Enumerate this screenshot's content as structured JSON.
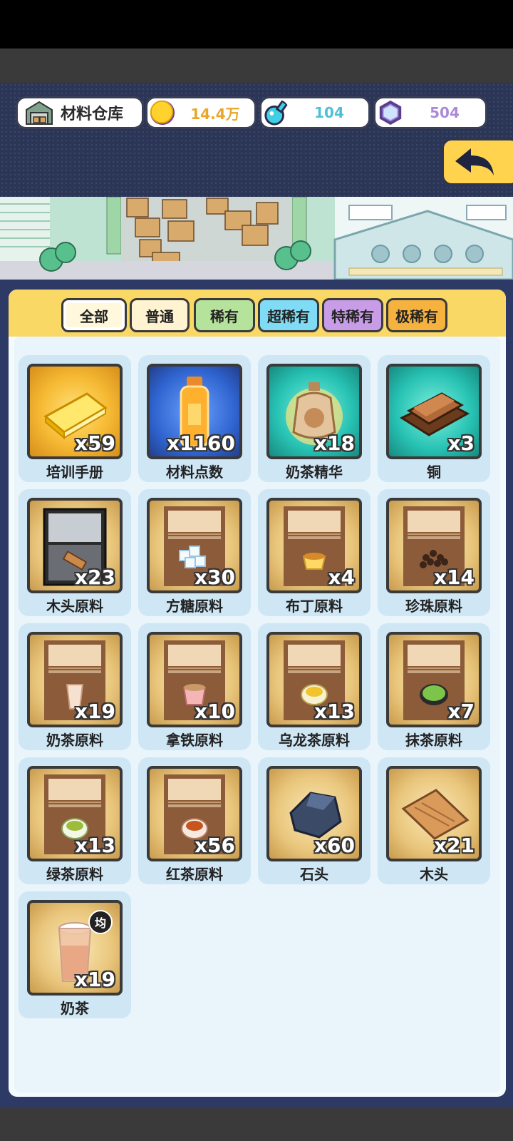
{
  "header": {
    "title": "材料仓库",
    "coins": "14.4万",
    "potion": "104",
    "gems": "504"
  },
  "colors": {
    "coin_text": "#e9a627",
    "potion_text": "#4fbfd8",
    "gem_text": "#a98bd8",
    "tab_all": "#fff8dc",
    "tab_common": "#fff3d2",
    "tab_rare": "#b5e39b",
    "tab_super": "#7fdcf4",
    "tab_special": "#c99ce8",
    "tab_extreme": "#f5b23e"
  },
  "tabs": [
    {
      "label": "全部",
      "active": true
    },
    {
      "label": "普通"
    },
    {
      "label": "稀有"
    },
    {
      "label": "超稀有"
    },
    {
      "label": "特稀有"
    },
    {
      "label": "极稀有"
    }
  ],
  "items": [
    {
      "name": "培训手册",
      "qty": "x59",
      "icon": "book-icon"
    },
    {
      "name": "材料点数",
      "qty": "x1160",
      "icon": "bottle-icon"
    },
    {
      "name": "奶茶精华",
      "qty": "x18",
      "icon": "essence-jar-icon"
    },
    {
      "name": "铜",
      "qty": "x3",
      "icon": "copper-ingot-icon"
    },
    {
      "name": "木头原料",
      "qty": "x23",
      "icon": "wood-box-icon"
    },
    {
      "name": "方糖原料",
      "qty": "x30",
      "icon": "sugar-cube-icon"
    },
    {
      "name": "布丁原料",
      "qty": "x4",
      "icon": "pudding-icon"
    },
    {
      "name": "珍珠原料",
      "qty": "x14",
      "icon": "pearl-icon"
    },
    {
      "name": "奶茶原料",
      "qty": "x19",
      "icon": "milk-tea-cup-icon"
    },
    {
      "name": "拿铁原料",
      "qty": "x10",
      "icon": "latte-cup-icon"
    },
    {
      "name": "乌龙茶原料",
      "qty": "x13",
      "icon": "oolong-cup-icon"
    },
    {
      "name": "抹茶原料",
      "qty": "x7",
      "icon": "matcha-bowl-icon"
    },
    {
      "name": "绿茶原料",
      "qty": "x13",
      "icon": "green-tea-cup-icon"
    },
    {
      "name": "红茶原料",
      "qty": "x56",
      "icon": "black-tea-cup-icon"
    },
    {
      "name": "石头",
      "qty": "x60",
      "icon": "stone-icon"
    },
    {
      "name": "木头",
      "qty": "x21",
      "icon": "wood-plank-icon"
    },
    {
      "name": "奶茶",
      "qty": "x19",
      "icon": "milk-tea-glass-icon",
      "badge": "均"
    }
  ]
}
